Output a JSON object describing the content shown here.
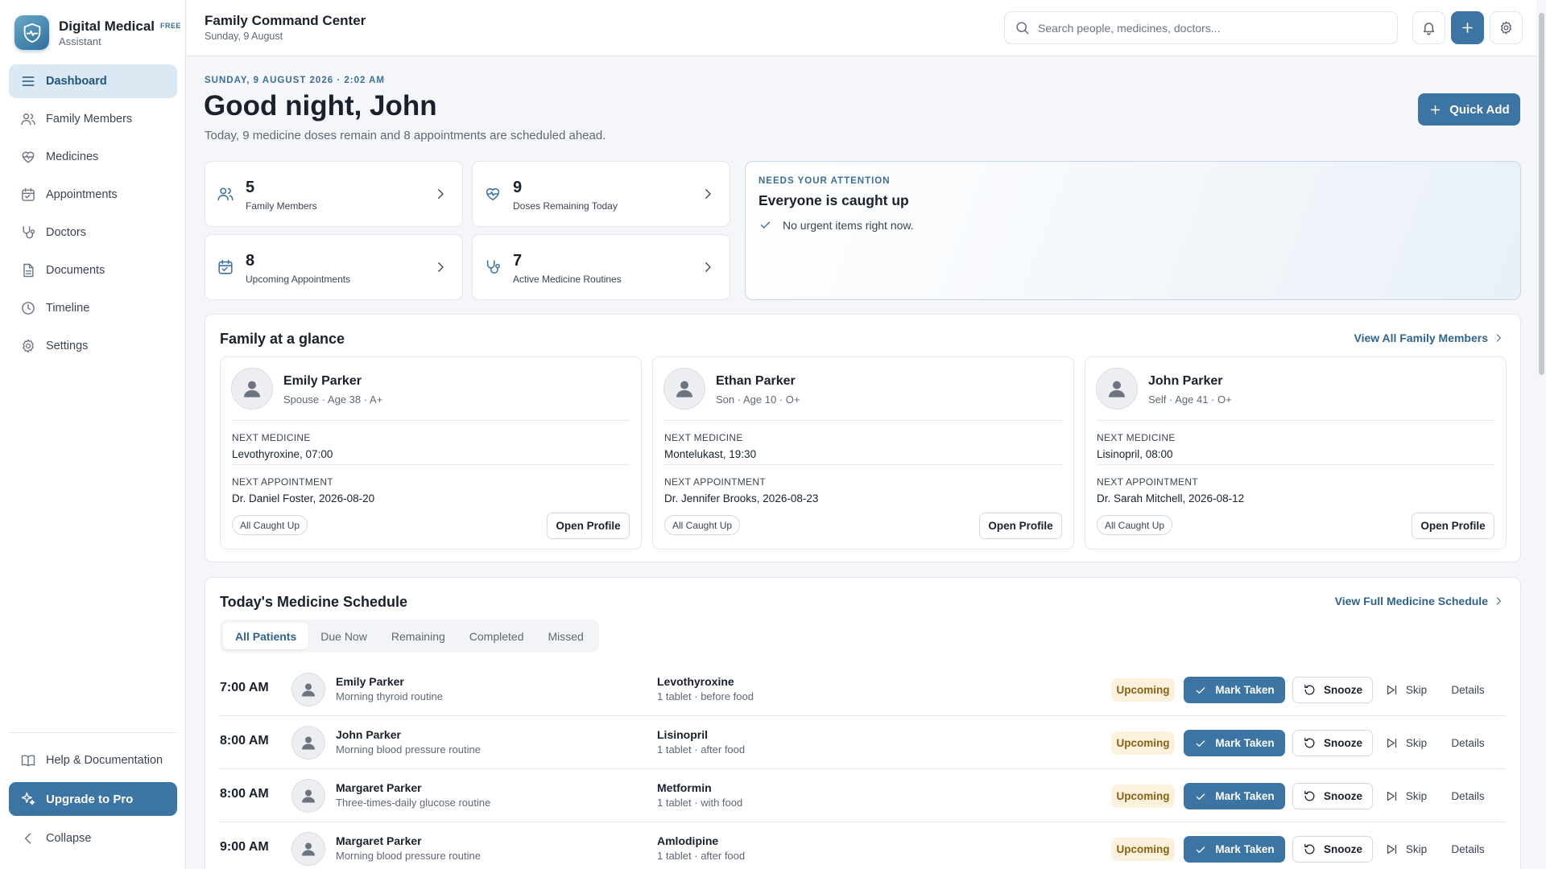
{
  "brand": {
    "title": "Digital Medical",
    "badge": "FREE",
    "subtitle": "Assistant"
  },
  "sidebar": {
    "items": [
      {
        "label": "Dashboard",
        "icon": "menu-icon",
        "active": true
      },
      {
        "label": "Family Members",
        "icon": "users-icon"
      },
      {
        "label": "Medicines",
        "icon": "heart-pulse-icon"
      },
      {
        "label": "Appointments",
        "icon": "calendar-icon"
      },
      {
        "label": "Doctors",
        "icon": "stethoscope-icon"
      },
      {
        "label": "Documents",
        "icon": "document-icon"
      },
      {
        "label": "Timeline",
        "icon": "clock-icon"
      },
      {
        "label": "Settings",
        "icon": "gear-icon"
      }
    ],
    "help": "Help & Documentation",
    "upgrade": "Upgrade to Pro",
    "collapse": "Collapse"
  },
  "header": {
    "title": "Family Command Center",
    "date": "Sunday, 9 August",
    "search_placeholder": "Search people, medicines, doctors..."
  },
  "greeting": {
    "eyebrow": "SUNDAY, 9 AUGUST 2026 · 2:02 AM",
    "title": "Good night, John",
    "subtitle": "Today, 9 medicine doses remain and 8 appointments are scheduled ahead.",
    "quick_add": "Quick Add"
  },
  "stats": [
    {
      "value": "5",
      "label": "Family Members",
      "icon": "users-icon"
    },
    {
      "value": "9",
      "label": "Doses Remaining Today",
      "icon": "heart-pulse-icon"
    },
    {
      "value": "8",
      "label": "Upcoming Appointments",
      "icon": "calendar-icon"
    },
    {
      "value": "7",
      "label": "Active Medicine Routines",
      "icon": "stethoscope-icon"
    }
  ],
  "attention": {
    "eyebrow": "NEEDS YOUR ATTENTION",
    "title": "Everyone is caught up",
    "message": "No urgent items right now."
  },
  "family": {
    "title": "Family at a glance",
    "view_all": "View All Family Members",
    "next_medicine_label": "NEXT MEDICINE",
    "next_appointment_label": "NEXT APPOINTMENT",
    "open_profile": "Open Profile",
    "members": [
      {
        "name": "Emily Parker",
        "meta": "Spouse · Age 38 · A+",
        "next_medicine": "Levothyroxine, 07:00",
        "next_appointment": "Dr. Daniel Foster, 2026-08-20",
        "status": "All Caught Up"
      },
      {
        "name": "Ethan Parker",
        "meta": "Son · Age 10 · O+",
        "next_medicine": "Montelukast, 19:30",
        "next_appointment": "Dr. Jennifer Brooks, 2026-08-23",
        "status": "All Caught Up"
      },
      {
        "name": "John Parker",
        "meta": "Self · Age 41 · O+",
        "next_medicine": "Lisinopril, 08:00",
        "next_appointment": "Dr. Sarah Mitchell, 2026-08-12",
        "status": "All Caught Up"
      }
    ]
  },
  "schedule": {
    "title": "Today's Medicine Schedule",
    "view_all": "View Full Medicine Schedule",
    "tabs": [
      {
        "label": "All Patients",
        "active": true
      },
      {
        "label": "Due Now"
      },
      {
        "label": "Remaining"
      },
      {
        "label": "Completed"
      },
      {
        "label": "Missed"
      }
    ],
    "actions": {
      "mark_taken": "Mark Taken",
      "snooze": "Snooze",
      "skip": "Skip",
      "details": "Details"
    },
    "rows": [
      {
        "time": "7:00 AM",
        "patient": "Emily Parker",
        "routine": "Morning thyroid routine",
        "medicine": "Levothyroxine",
        "dose": "1 tablet · before food",
        "status": "Upcoming"
      },
      {
        "time": "8:00 AM",
        "patient": "John Parker",
        "routine": "Morning blood pressure routine",
        "medicine": "Lisinopril",
        "dose": "1 tablet · after food",
        "status": "Upcoming"
      },
      {
        "time": "8:00 AM",
        "patient": "Margaret Parker",
        "routine": "Three-times-daily glucose routine",
        "medicine": "Metformin",
        "dose": "1 tablet · with food",
        "status": "Upcoming"
      },
      {
        "time": "9:00 AM",
        "patient": "Margaret Parker",
        "routine": "Morning blood pressure routine",
        "medicine": "Amlodipine",
        "dose": "1 tablet · after food",
        "status": "Upcoming"
      }
    ]
  },
  "colors": {
    "accent": "#3c74a3",
    "active_nav_bg": "#dbe9f4",
    "status_upcoming_bg": "#fbf1dc",
    "status_upcoming_text": "#8a6115"
  }
}
